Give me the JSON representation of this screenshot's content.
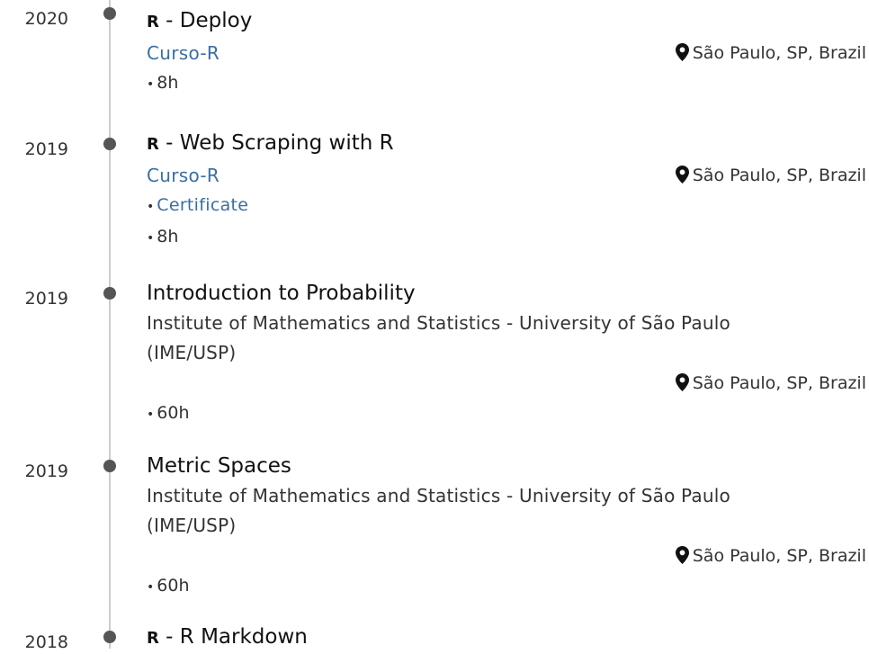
{
  "entries": [
    {
      "year": "2020",
      "prefix": "R",
      "title": " - Deploy",
      "institution": "Curso-R",
      "location": "São Paulo, SP, Brazil",
      "details": [
        "8h"
      ]
    },
    {
      "year": "2019",
      "prefix": "R",
      "title": " - Web Scraping with R",
      "institution": "Curso-R",
      "location": "São Paulo, SP, Brazil",
      "details_link": "Certificate",
      "details": [
        "8h"
      ]
    },
    {
      "year": "2019",
      "title": "Introduction to Probability",
      "institution_line1": "Institute of Mathematics and Statistics - University of São Paulo",
      "institution_line2": "(IME/USP)",
      "location": "São Paulo, SP, Brazil",
      "details": [
        "60h"
      ]
    },
    {
      "year": "2019",
      "title": "Metric Spaces",
      "institution_line1": "Institute of Mathematics and Statistics - University of São Paulo",
      "institution_line2": "(IME/USP)",
      "location": "São Paulo, SP, Brazil",
      "details": [
        "60h"
      ]
    },
    {
      "year": "2018",
      "prefix": "R",
      "title": " - R Markdown"
    }
  ],
  "bullet": "•",
  "icons": {
    "location": "map-marker-icon"
  },
  "colors": {
    "link": "#3a6ea5",
    "dot": "#555555",
    "line": "#cccccc"
  }
}
